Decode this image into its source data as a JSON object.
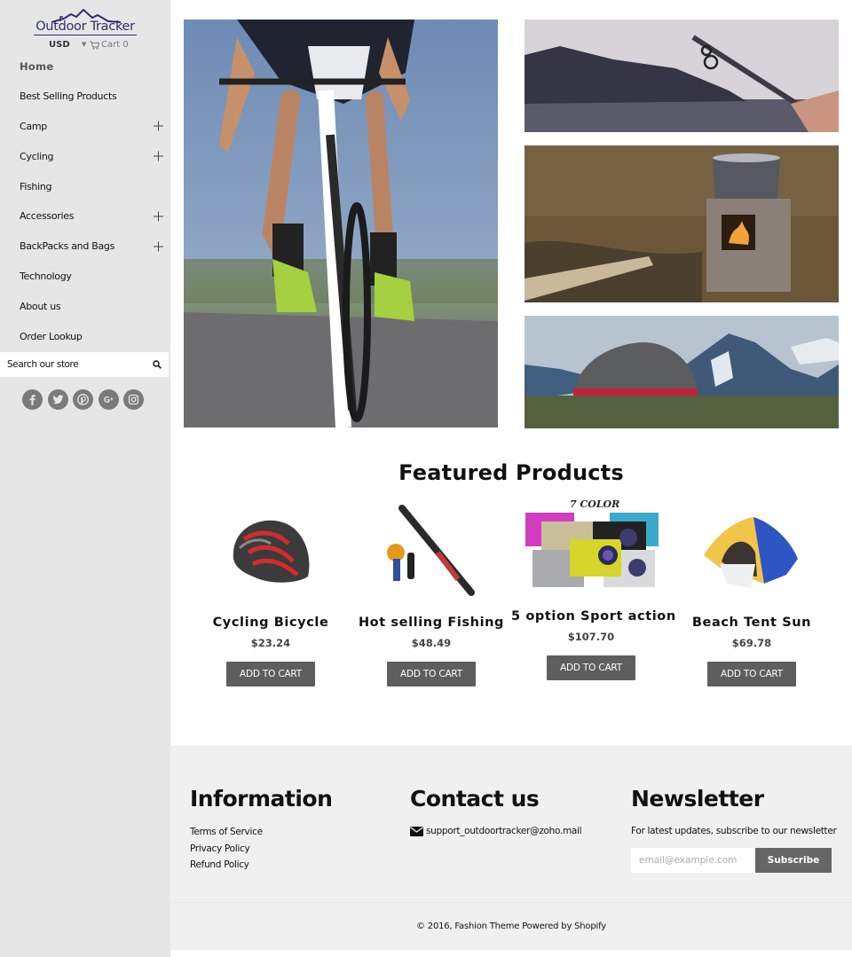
{
  "brand": {
    "name": "Outdoor Tracker",
    "currency": "USD",
    "cart_label": "Cart 0"
  },
  "sidebar": {
    "items": [
      {
        "label": "Home",
        "expandable": false
      },
      {
        "label": "Best Selling Products",
        "expandable": false
      },
      {
        "label": "Camp",
        "expandable": true
      },
      {
        "label": "Cycling",
        "expandable": true
      },
      {
        "label": "Fishing",
        "expandable": false
      },
      {
        "label": "Accessories",
        "expandable": true
      },
      {
        "label": "BackPacks and Bags",
        "expandable": true
      },
      {
        "label": "Technology",
        "expandable": false
      },
      {
        "label": "About us",
        "expandable": false
      },
      {
        "label": "Order Lookup",
        "expandable": false
      }
    ],
    "search_placeholder": "Search our store",
    "socials": [
      "facebook",
      "twitter",
      "pinterest",
      "google-plus",
      "instagram"
    ]
  },
  "hero": {
    "images": [
      "cyclist-on-road",
      "fishing-rod-lake",
      "camp-stove-pot",
      "tent-mountains"
    ]
  },
  "featured": {
    "title": "Featured Products",
    "products": [
      {
        "name": "Cycling Bicycle",
        "price": "$23.24",
        "button": "ADD TO CART",
        "image": "bike-helmet"
      },
      {
        "name": "Hot selling Fishing",
        "price": "$48.49",
        "button": "ADD TO CART",
        "image": "fishing-rod-reel"
      },
      {
        "name": "5 option Sport action",
        "price": "$107.70",
        "button": "ADD TO CART",
        "image": "action-cameras",
        "badge": "7 COLOR"
      },
      {
        "name": "Beach Tent Sun",
        "price": "$69.78",
        "button": "ADD TO CART",
        "image": "dome-tent"
      }
    ]
  },
  "footer": {
    "information": {
      "title": "Information",
      "links": [
        "Terms of Service",
        "Privacy Policy",
        "Refund Policy"
      ]
    },
    "contact": {
      "title": "Contact us",
      "email": "support_outdoortracker@zoho.mail"
    },
    "newsletter": {
      "title": "Newsletter",
      "description": "For latest updates, subscribe to our newsletter",
      "placeholder": "email@example.com",
      "button": "Subscribe"
    },
    "copyright": "© 2016, Fashion Theme Powered by Shopify"
  }
}
